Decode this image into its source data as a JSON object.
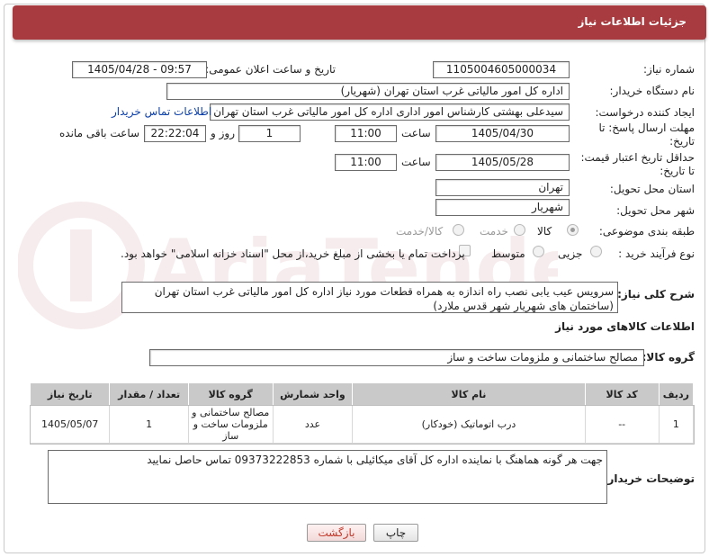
{
  "header": {
    "title": "جزئیات اطلاعات نیاز"
  },
  "need_number": {
    "label": "شماره نیاز:",
    "value": "1105004605000034"
  },
  "announce_datetime": {
    "label": "تاریخ و ساعت اعلان عمومی:",
    "value": "1405/04/28 - 09:57"
  },
  "buyer_org": {
    "label": "نام دستگاه خریدار:",
    "value": "اداره کل امور مالیاتی غرب استان تهران (شهریار)"
  },
  "requester": {
    "label": "ایجاد کننده درخواست:",
    "value": "سیدعلی بهشتی کارشناس امور اداری اداره کل امور مالیاتی غرب استان تهران (",
    "contact_link": "اطلاعات تماس خریدار"
  },
  "response_deadline": {
    "label_line1": "مهلت ارسال پاسخ: تا",
    "label_line2": "تاریخ:",
    "date": "1405/04/30",
    "time_label": "ساعت",
    "time": "11:00",
    "days": "1",
    "days_label": "روز و",
    "remaining": "22:22:04",
    "remaining_label": "ساعت باقی مانده"
  },
  "price_validity": {
    "label_line1": "حداقل تاریخ اعتبار قیمت:",
    "label_line2": "تا تاریخ:",
    "date": "1405/05/28",
    "time_label": "ساعت",
    "time": "11:00"
  },
  "delivery_province": {
    "label": "استان محل تحویل:",
    "value": "تهران"
  },
  "delivery_city": {
    "label": "شهر محل تحویل:",
    "value": "شهریار"
  },
  "category": {
    "label": "طبقه بندی موضوعی:",
    "options": [
      "کالا",
      "خدمت",
      "کالا/خدمت"
    ],
    "selected": "کالا"
  },
  "purchase_process": {
    "label": "نوع فرآیند خرید :",
    "options": [
      "جزیی",
      "متوسط"
    ],
    "payment_note": "پرداخت تمام یا بخشی از مبلغ خرید،از محل \"اسناد خزانه اسلامی\" خواهد بود."
  },
  "description": {
    "label": "شرح کلی نیاز:",
    "value": "سرویس عیب یابی نصب راه اندازه به همراه قطعات مورد نیاز اداره کل امور مالیاتی غرب استان تهران (ساختمان های شهریار شهر قدس ملارد)"
  },
  "goods_info": {
    "title": "اطلاعات کالاهای مورد نیاز"
  },
  "goods_group": {
    "label": "گروه کالا:",
    "value": "مصالح ساختمانی و ملزومات ساخت و ساز"
  },
  "items_table": {
    "headers": [
      "ردیف",
      "کد کالا",
      "نام کالا",
      "واحد شمارش",
      "گروه کالا",
      "تعداد / مقدار",
      "تاریخ نیاز"
    ],
    "rows": [
      [
        "1",
        "--",
        "درب اتوماتیک (خودکار)",
        "عدد",
        "مصالح ساختمانی و ملزومات ساخت و ساز",
        "1",
        "1405/05/07"
      ]
    ]
  },
  "buyer_notes": {
    "label": "توضیحات خریدار:",
    "value": "جهت هر گونه هماهنگ با نماینده اداره کل آقای میکائیلی با شماره 09373222853 تماس حاصل نمایید"
  },
  "buttons": {
    "print": "چاپ",
    "back": "بازگشت"
  },
  "colors": {
    "header": "#a83b40",
    "link": "#0b3fa8",
    "table_header": "#c9c9c9"
  }
}
